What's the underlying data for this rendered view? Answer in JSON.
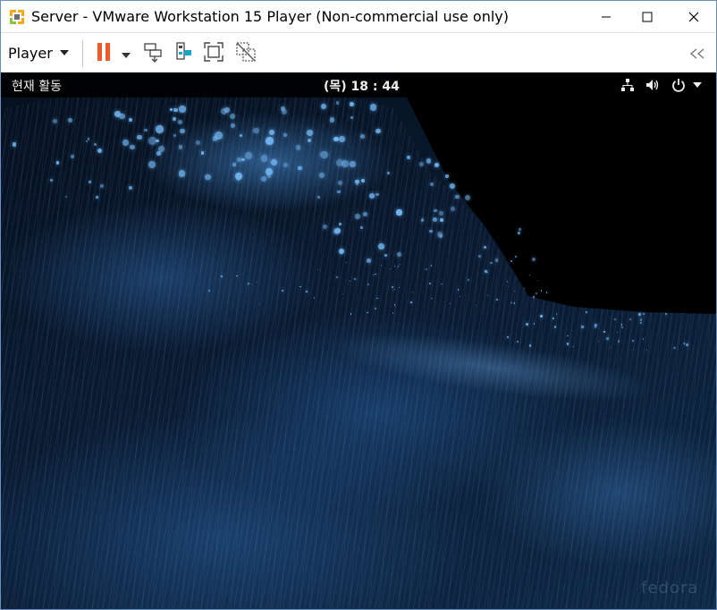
{
  "window": {
    "title": "Server - VMware Workstation 15 Player (Non-commercial use only)",
    "icon": "vmware-player-logo-icon",
    "controls": {
      "minimize": "minimize-icon",
      "maximize": "maximize-icon",
      "close": "close-icon"
    }
  },
  "toolbar": {
    "player_menu_label": "Player",
    "icons": [
      "chevron-down-icon",
      "pause-icon",
      "chevron-down-icon",
      "send-ctrl-alt-del-icon",
      "removable-devices-icon",
      "full-screen-icon",
      "unity-mode-icon",
      "collapse-toolbar-icon"
    ],
    "colors": {
      "pause": "#f05a28",
      "usb_accent": "#1aa3c4"
    }
  },
  "guest": {
    "top_bar": {
      "activities_label": "현재 활동",
      "clock": "(목) 18 : 44",
      "tray_icons": [
        "network-icon",
        "volume-icon",
        "power-icon",
        "chevron-down-icon"
      ]
    },
    "wallpaper": {
      "description_colors": {
        "primary": "#2d6fb3",
        "highlight": "#6fb3ee",
        "background": "#000000"
      },
      "watermark": "fedora"
    }
  }
}
